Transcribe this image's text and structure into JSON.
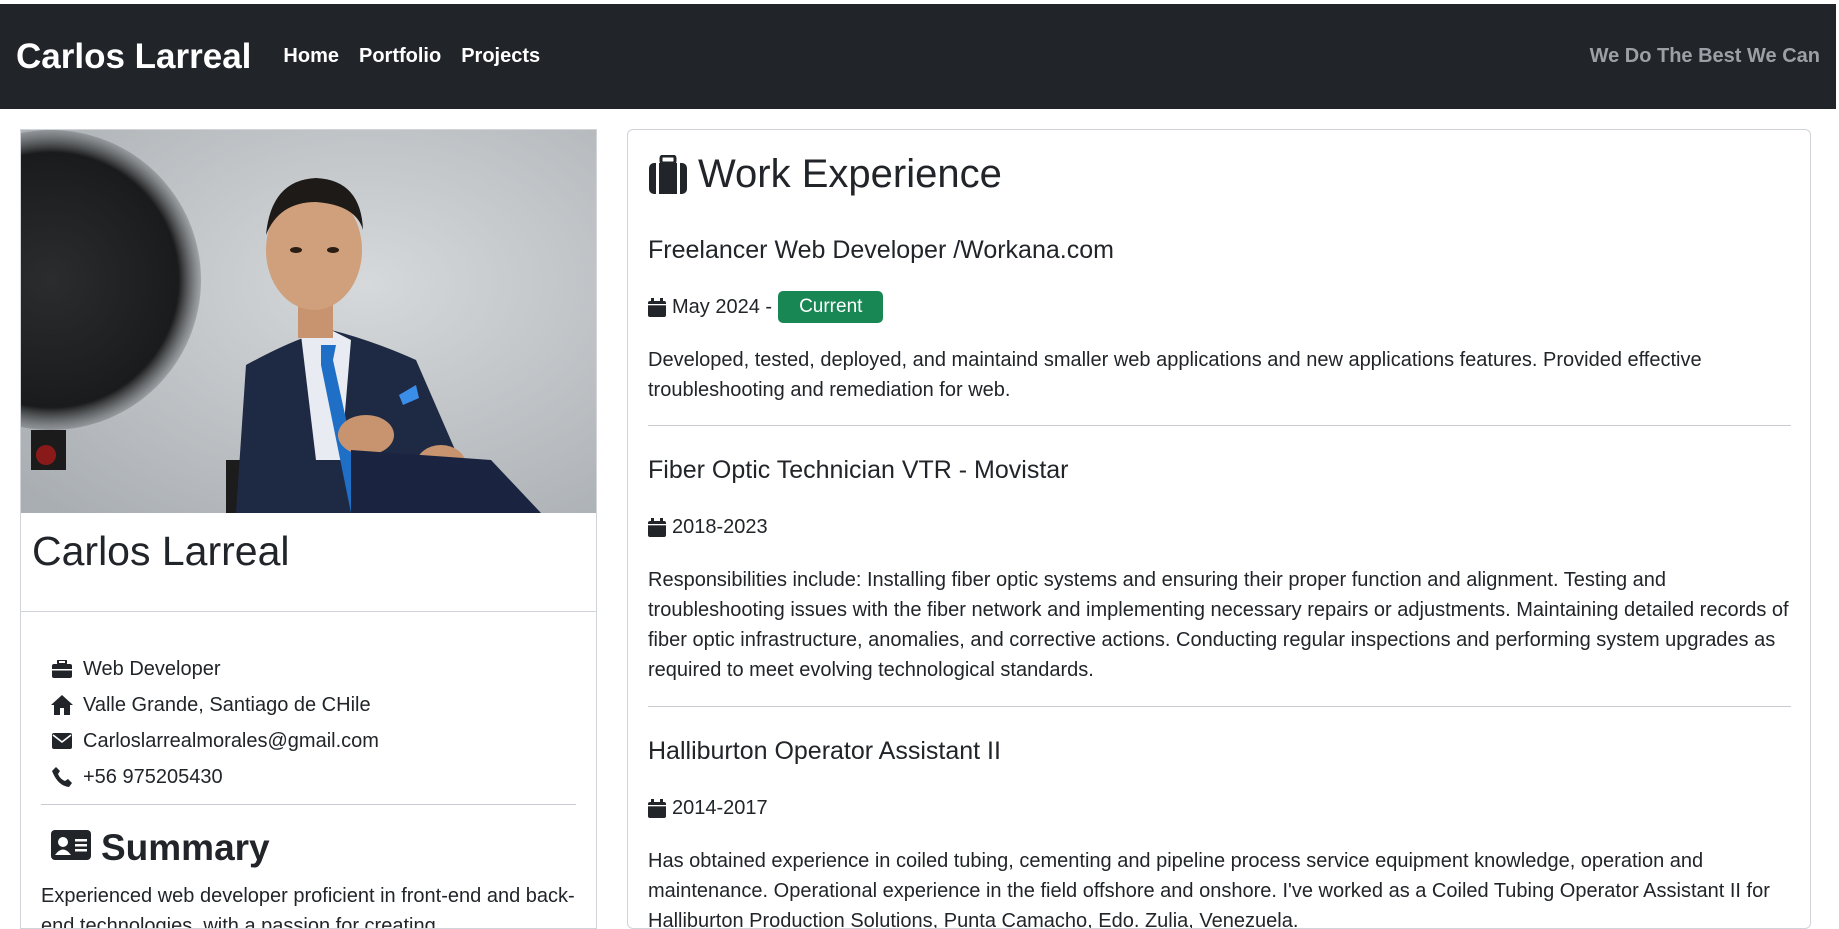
{
  "navbar": {
    "brand": "Carlos Larreal",
    "links": [
      "Home",
      "Portfolio",
      "Projects"
    ],
    "tagline": "We Do The Best We Can"
  },
  "profile": {
    "name": "Carlos Larreal",
    "info": [
      {
        "icon": "briefcase-icon",
        "text": "Web Developer"
      },
      {
        "icon": "home-icon",
        "text": "Valle Grande, Santiago de CHile"
      },
      {
        "icon": "envelope-icon",
        "text": "Carloslarrealmorales@gmail.com"
      },
      {
        "icon": "phone-icon",
        "text": "+56 975205430"
      }
    ],
    "summary_title": "Summary",
    "summary_text": "Experienced web developer proficient in front-end and back-end technologies, with a passion for creating"
  },
  "experience": {
    "title": "Work Experience",
    "jobs": [
      {
        "title": "Freelancer Web Developer /Workana.com",
        "date": "May 2024 -",
        "badge": "Current",
        "description": "Developed, tested, deployed, and maintaind smaller web applications and new applications features. Provided effective troubleshooting and remediation for web."
      },
      {
        "title": "Fiber Optic Technician VTR - Movistar",
        "date": "2018-2023",
        "description": "Responsibilities include: Installing fiber optic systems and ensuring their proper function and alignment. Testing and troubleshooting issues with the fiber network and implementing necessary repairs or adjustments. Maintaining detailed records of fiber optic infrastructure, anomalies, and corrective actions. Conducting regular inspections and performing system upgrades as required to meet evolving technological standards."
      },
      {
        "title": "Halliburton Operator Assistant II",
        "date": "2014-2017",
        "description": "Has obtained experience in coiled tubing, cementing and pipeline process service equipment knowledge, operation and maintenance. Operational experience in the field offshore and onshore. I've worked as a Coiled Tubing Operator Assistant II for Halliburton Production Solutions, Punta Camacho, Edo. Zulia, Venezuela."
      }
    ]
  },
  "colors": {
    "navbar_bg": "#212529",
    "badge_green": "#198754"
  }
}
